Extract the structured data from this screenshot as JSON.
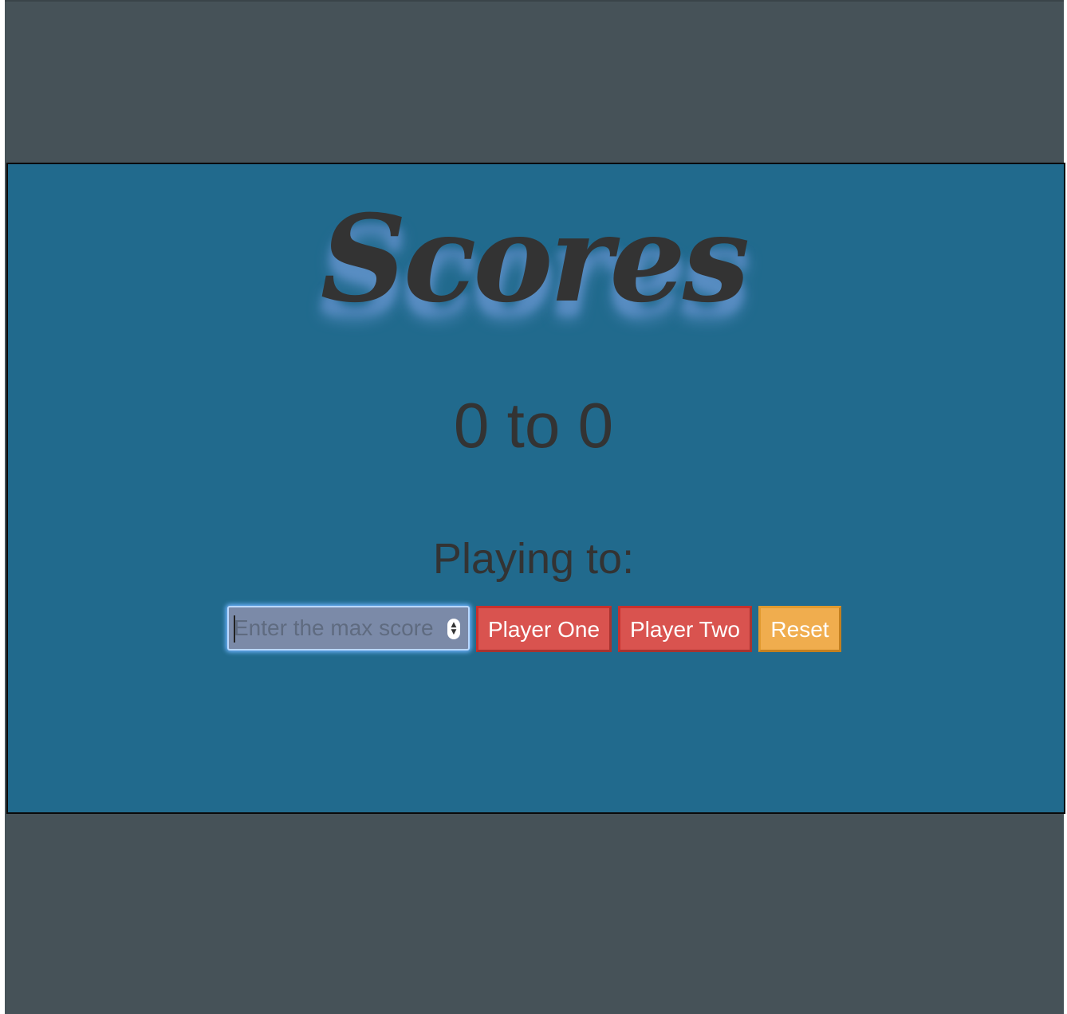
{
  "page": {
    "title": "Scores",
    "score_text": "0 to 0",
    "playing_to_label": "Playing to:"
  },
  "controls": {
    "max_score_input": {
      "value": "",
      "placeholder": "Enter the max score"
    },
    "player_one_label": "Player One",
    "player_two_label": "Player Two",
    "reset_label": "Reset"
  },
  "icons": {
    "stepper_up": "▲",
    "stepper_down": "▼"
  },
  "colors": {
    "background": "#465258",
    "panel": "#216a8d",
    "text": "#333333",
    "title_glow": "#5a8fc4",
    "danger_button": "#d9534f",
    "warning_button": "#f0ad4e",
    "focus_ring": "#6fb4ff"
  }
}
